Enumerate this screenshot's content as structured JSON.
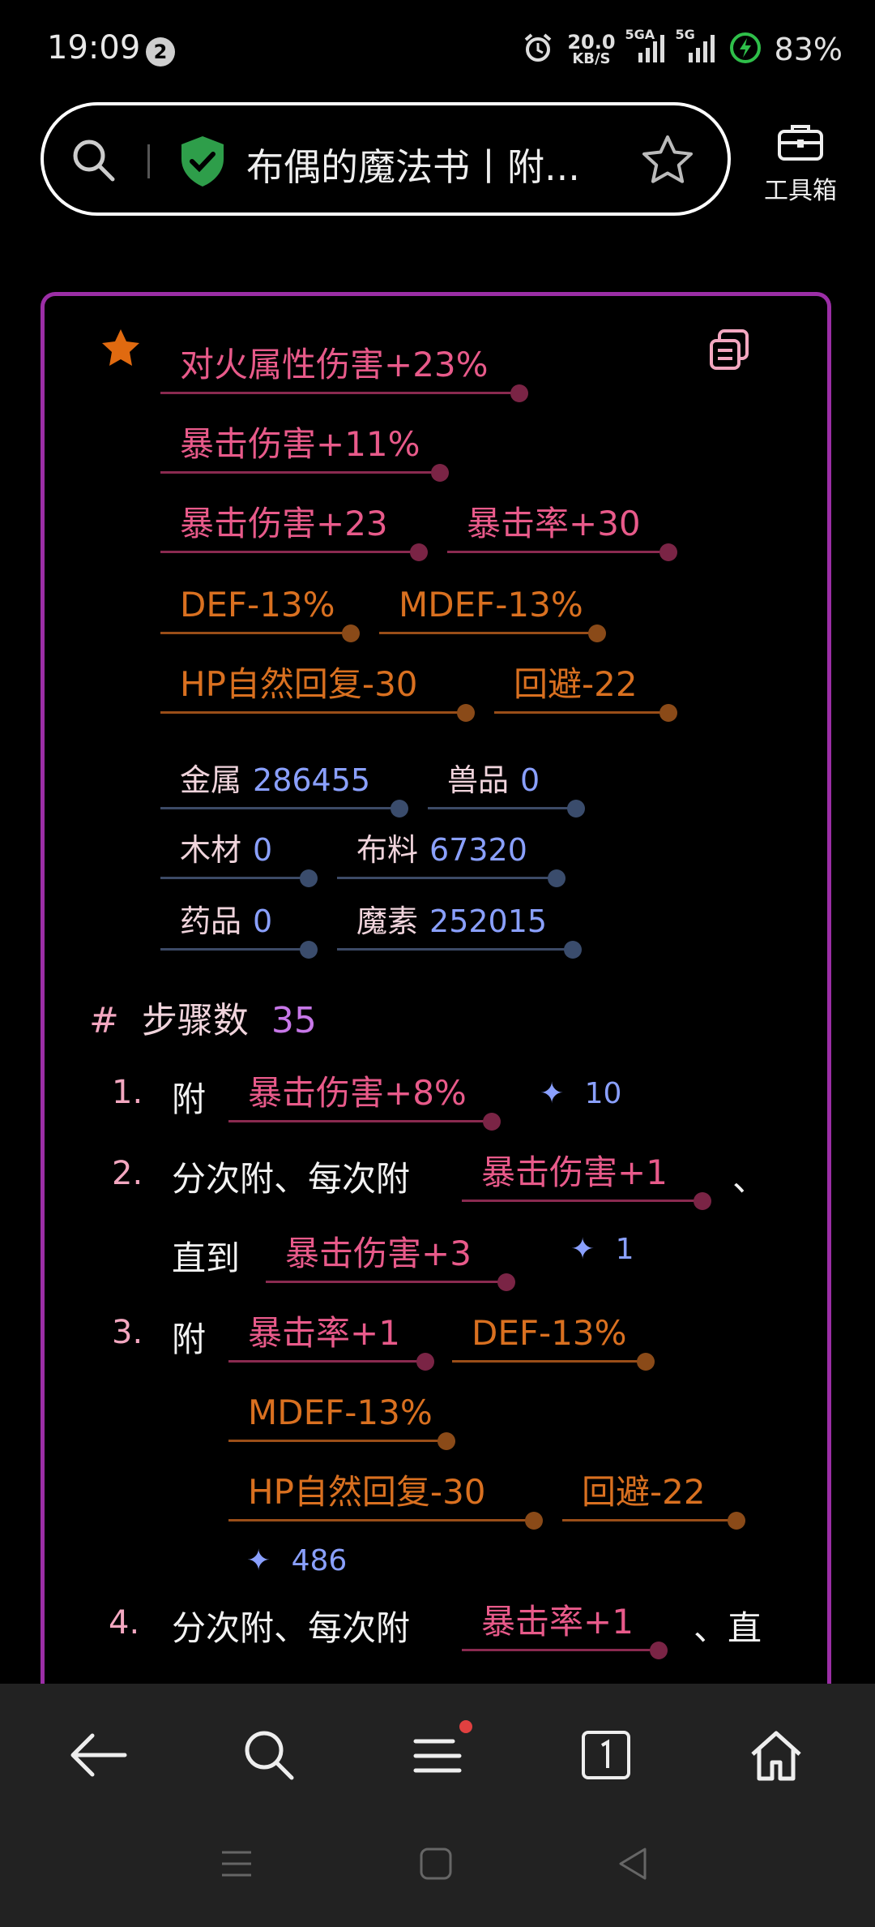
{
  "status_bar": {
    "time": "19:09",
    "notification_count": "2",
    "net_speed_value": "20.0",
    "net_speed_unit": "KB/S",
    "signal1_label": "5GA",
    "signal2_label": "5G",
    "battery": "83%"
  },
  "browser": {
    "page_title": "布偶的魔法书丨附...",
    "toolbox_label": "工具箱"
  },
  "effects": {
    "row1": [
      "对火属性伤害+23%"
    ],
    "row2": [
      "暴击伤害+11%"
    ],
    "row3": [
      "暴击伤害+23",
      "暴击率+30"
    ],
    "row4": [
      "DEF-13%",
      "MDEF-13%"
    ],
    "row5": [
      "HP自然回复-30",
      "回避-22"
    ]
  },
  "resources": [
    {
      "label": "金属",
      "value": "286455"
    },
    {
      "label": "兽品",
      "value": "0"
    },
    {
      "label": "木材",
      "value": "0"
    },
    {
      "label": "布料",
      "value": "67320"
    },
    {
      "label": "药品",
      "value": "0"
    },
    {
      "label": "魔素",
      "value": "252015"
    }
  ],
  "steps_header": {
    "hash": "#",
    "label": "步骤数",
    "count": "35"
  },
  "steps": {
    "s1": {
      "num": "1.",
      "prefix": "附",
      "tag": "暴击伤害+8%",
      "cost": "10"
    },
    "s2": {
      "num": "2.",
      "prefix": "分次附、每次附",
      "tag": "暴击伤害+1",
      "sep": "、",
      "until": "直到",
      "tag2": "暴击伤害+3",
      "cost": "1"
    },
    "s3": {
      "num": "3.",
      "prefix": "附",
      "tags": [
        "暴击率+1",
        "DEF-13%",
        "MDEF-13%",
        "HP自然回复-30",
        "回避-22"
      ],
      "cost": "486"
    },
    "s4": {
      "num": "4.",
      "prefix": "分次附、每次附",
      "tag": "暴击率+1",
      "suffix": "、直"
    }
  },
  "icons": {
    "star": "star-icon",
    "copy": "copy-icon",
    "sparkle": "sparkle-icon"
  },
  "colors": {
    "card_border": "#9b2ea6",
    "pink_tag": "#e85a8a",
    "orange_tag": "#d97020",
    "resource_value": "#8aa0ff",
    "star": "#e06a10",
    "shield": "#2e9e4a"
  }
}
